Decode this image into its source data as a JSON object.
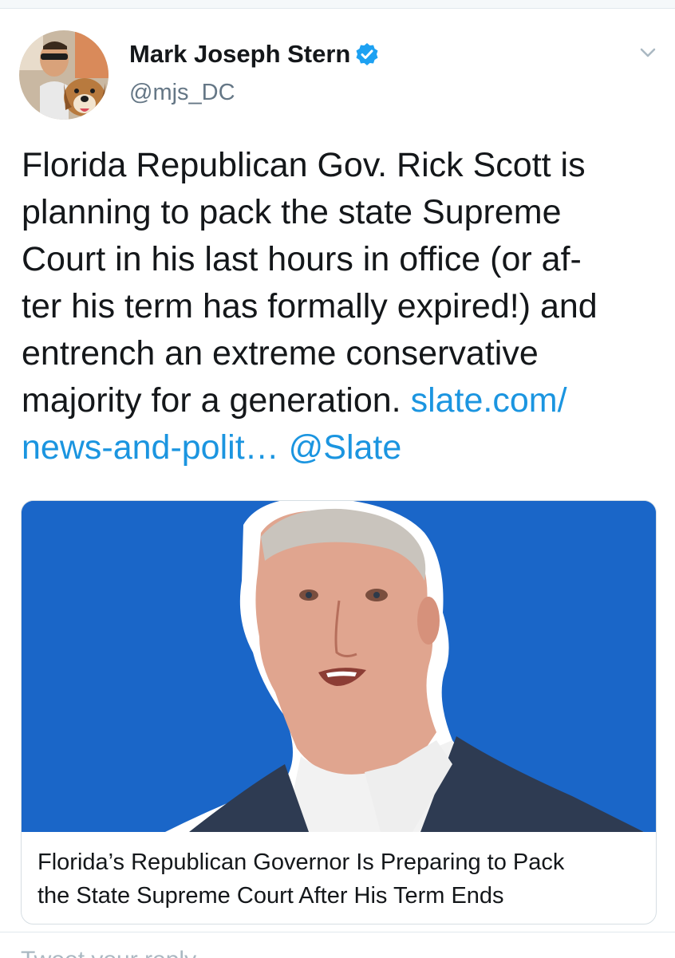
{
  "author": {
    "display_name": "Mark Joseph Stern",
    "handle": "@mjs_DC",
    "verified_icon": "verified-badge-icon",
    "avatar": "profile-photo-man-with-dog"
  },
  "tweet": {
    "lines": [
      "Florida Republican Gov. Rick Scott is",
      "planning to pack the state Supreme",
      "Court in his last hours in office (or af-",
      "ter his term has formally expired!) and",
      "entrench an extreme conservative"
    ],
    "line6_text": "majority for a generation.",
    "link_part1": "slate.com/",
    "link_part2": "news-and-polit…",
    "mention": "@Slate"
  },
  "card": {
    "title_line1": "Florida’s Republican Governor Is Preparing to Pack",
    "title_line2": "the State Supreme Court After His Term Ends",
    "image": "portrait-of-man-in-suit-on-blue-background"
  },
  "reply": {
    "placeholder": "Tweet your reply"
  },
  "colors": {
    "link": "#1b95e0",
    "card_background": "#1a66c8",
    "secondary_text": "#657786"
  }
}
